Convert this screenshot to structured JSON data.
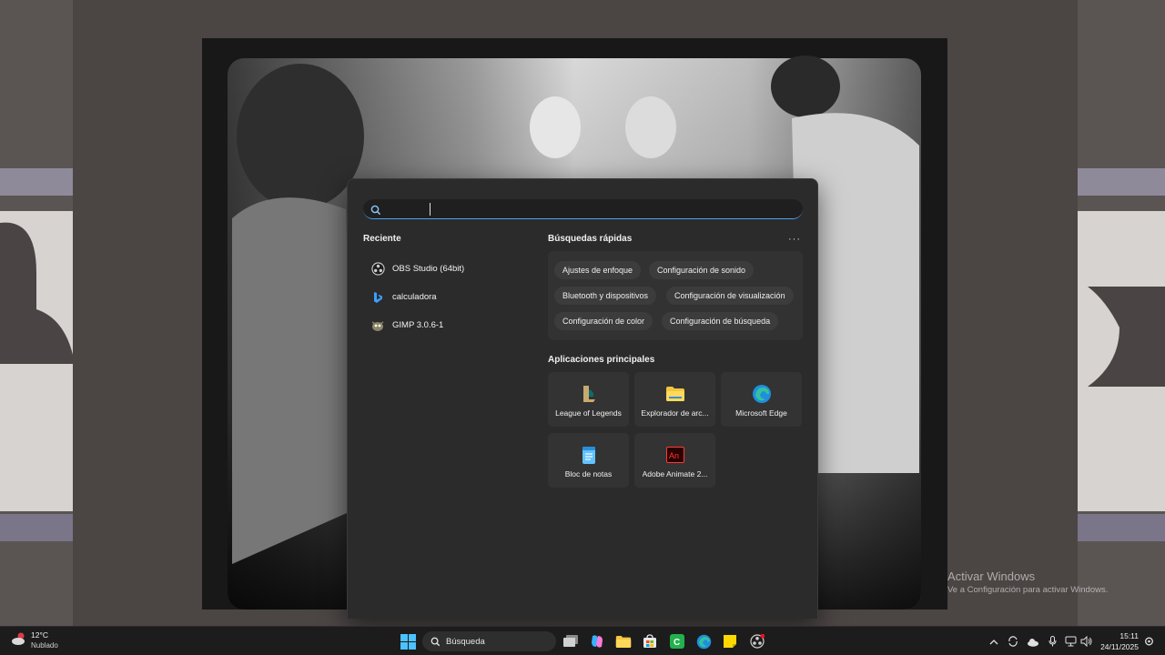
{
  "search": {
    "placeholder": "",
    "recent_title": "Reciente",
    "recent_items": [
      {
        "label": "OBS Studio (64bit)",
        "icon": "obs-icon"
      },
      {
        "label": "calculadora",
        "icon": "bing-icon"
      },
      {
        "label": "GIMP 3.0.6-1",
        "icon": "gimp-icon"
      }
    ],
    "quick_title": "Búsquedas rápidas",
    "more_label": "···",
    "quick_searches": [
      "Ajustes de enfoque",
      "Configuración de sonido",
      "Bluetooth y dispositivos",
      "Configuración de visualización",
      "Configuración de color",
      "Configuración de búsqueda"
    ],
    "apps_title": "Aplicaciones principales",
    "top_apps": [
      {
        "label": "League of Legends",
        "icon": "league-of-legends-icon"
      },
      {
        "label": "Explorador de arc...",
        "icon": "folder-icon"
      },
      {
        "label": "Microsoft Edge",
        "icon": "edge-icon"
      },
      {
        "label": "Bloc de notas",
        "icon": "notepad-icon"
      },
      {
        "label": "Adobe Animate 2...",
        "icon": "adobe-animate-icon"
      }
    ]
  },
  "watermark": {
    "title": "Activar Windows",
    "subtitle": "Ve a Configuración para activar Windows."
  },
  "taskbar": {
    "weather_temp": "12°C",
    "weather_condition": "Nublado",
    "search_label": "Búsqueda",
    "pinned": [
      "windows-start-icon",
      "task-view-icon",
      "copilot-icon",
      "file-explorer-icon",
      "store-icon",
      "camtasia-icon",
      "edge-icon",
      "sticky-notes-icon",
      "obs-icon"
    ],
    "time": "15:11",
    "date": "24/11/2025"
  },
  "colors": {
    "accent": "#4aa3f0",
    "flyout_bg": "#2b2b2b",
    "taskbar_bg": "#1c1c1c"
  }
}
